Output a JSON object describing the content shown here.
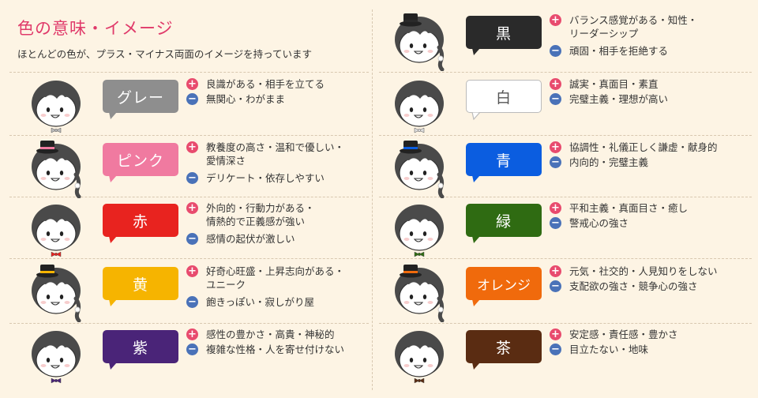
{
  "header": {
    "title": "色の意味・イメージ",
    "subtitle": "ほとんどの色が、プラス・マイナス両面のイメージを持っています"
  },
  "colors": {
    "title": "#e03a6a",
    "plus": "#e84b6e",
    "minus": "#4a72b8"
  },
  "left": [
    {
      "name": "グレー",
      "bubble_color": "#8e8e8e",
      "hat": false,
      "bow": "#bbbbbb",
      "hair_bow": false,
      "plus": "良識がある・相手を立てる",
      "minus": "無関心・わがまま"
    },
    {
      "name": "ピンク",
      "bubble_color": "#f07aa0",
      "hat": true,
      "hat_band": "#f07aa0",
      "bow": null,
      "hair_bow": true,
      "plus": "教養度の高さ・温和で優しい・\n愛情深さ",
      "minus": "デリケート・依存しやすい"
    },
    {
      "name": "赤",
      "bubble_color": "#e8231f",
      "hat": false,
      "bow": "#e8231f",
      "hair_bow": false,
      "plus": "外向的・行動力がある・\n情熱的で正義感が強い",
      "minus": "感情の起伏が激しい"
    },
    {
      "name": "黄",
      "bubble_color": "#f6b400",
      "hat": true,
      "hat_band": "#f6b400",
      "bow": null,
      "hair_bow": true,
      "plus": "好奇心旺盛・上昇志向がある・\nユニーク",
      "minus": "飽きっぽい・寂しがり屋"
    },
    {
      "name": "紫",
      "bubble_color": "#4a2478",
      "hat": false,
      "bow": "#4a2478",
      "hair_bow": false,
      "plus": "感性の豊かさ・高貴・神秘的",
      "minus": "複雑な性格・人を寄せ付けない"
    }
  ],
  "right": [
    {
      "name": "黒",
      "bubble_color": "#2a2a2a",
      "hat": true,
      "hat_band": "#2a2a2a",
      "bow": null,
      "hair_bow": true,
      "plus": "バランス感覚がある・知性・\nリーダーシップ",
      "minus": "頑固・相手を拒絶する"
    },
    {
      "name": "白",
      "bubble_color": "#ffffff",
      "hat": false,
      "bow": "#dddddd",
      "hair_bow": false,
      "plus": "誠実・真面目・素直",
      "minus": "完璧主義・理想が高い"
    },
    {
      "name": "青",
      "bubble_color": "#0b5de0",
      "hat": true,
      "hat_band": "#0b5de0",
      "bow": null,
      "hair_bow": true,
      "plus": "協調性・礼儀正しく謙虚・献身的",
      "minus": "内向的・完璧主義"
    },
    {
      "name": "緑",
      "bubble_color": "#2f6b12",
      "hat": false,
      "bow": "#2f6b12",
      "hair_bow": false,
      "plus": "平和主義・真面目さ・癒し",
      "minus": "警戒心の強さ"
    },
    {
      "name": "オレンジ",
      "bubble_color": "#f06a0c",
      "hat": true,
      "hat_band": "#f06a0c",
      "bow": null,
      "hair_bow": true,
      "plus": "元気・社交的・人見知りをしない",
      "minus": "支配欲の強さ・競争心の強さ"
    },
    {
      "name": "茶",
      "bubble_color": "#5a2c12",
      "hat": false,
      "bow": "#5a2c12",
      "hair_bow": false,
      "plus": "安定感・責任感・豊かさ",
      "minus": "目立たない・地味"
    }
  ]
}
